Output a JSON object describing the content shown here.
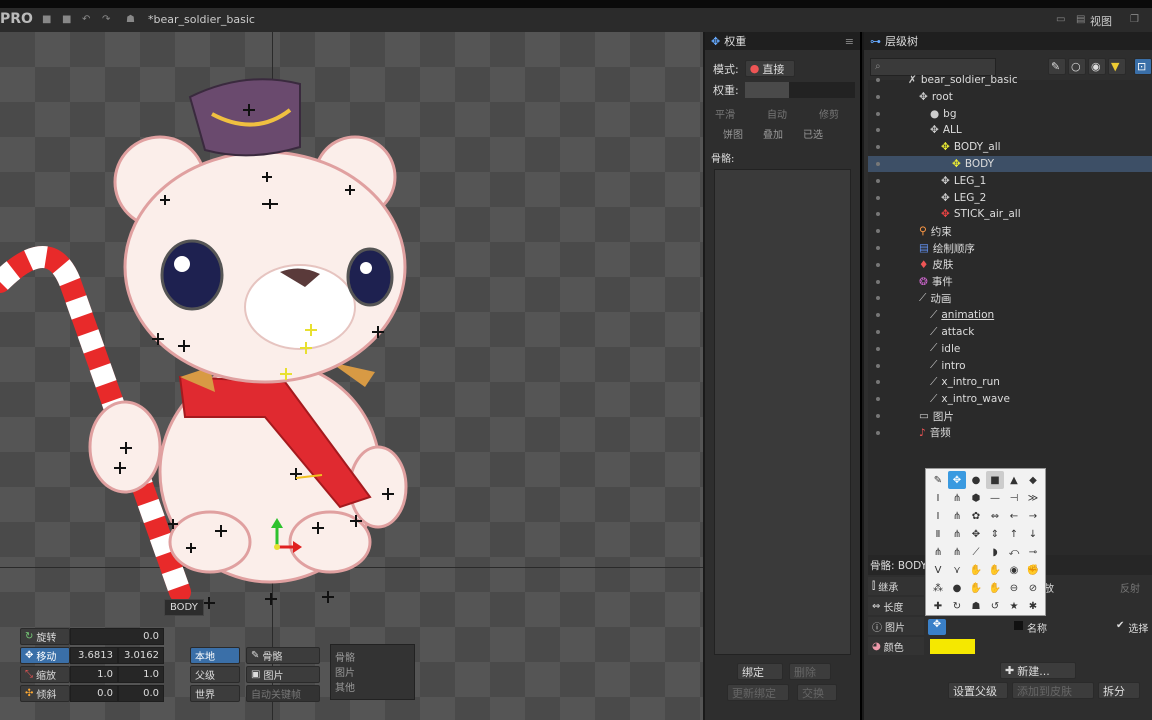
{
  "app": {
    "logo": "PRO",
    "doc_title": "*bear_soldier_basic",
    "view_label": "视图"
  },
  "viewport": {
    "bone_tag": "BODY"
  },
  "tools": {
    "rotate": {
      "label": "旋转",
      "v1": "0.0"
    },
    "translate": {
      "label": "移动",
      "v1": "3.6813",
      "v2": "3.0162"
    },
    "scale": {
      "label": "缩放",
      "v1": "1.0",
      "v2": "1.0"
    },
    "shear": {
      "label": "倾斜",
      "v1": "0.0",
      "v2": "0.0"
    },
    "local": "本地",
    "parent": "父级",
    "world": "世界",
    "bones": "骨骼",
    "images": "图片",
    "auto_key": "自动关键帧",
    "vis_bones": "骨骼",
    "vis_images": "图片",
    "vis_other": "其他"
  },
  "weights": {
    "tab": "权重",
    "mode_label": "模式:",
    "mode_value": "直接",
    "weight_label": "权重:",
    "smooth": "平滑",
    "auto": "自动",
    "prune": "修剪",
    "pie": "饼图",
    "overlay": "叠加",
    "selected": "已选",
    "bones_label": "骨骼:",
    "bind": "绑定",
    "delete": "删除",
    "update_bind": "更新绑定",
    "swap": "交换"
  },
  "tree": {
    "tab": "层级树",
    "search_placeholder": "",
    "nodes": [
      {
        "label": "bear_soldier_basic",
        "indent": 0,
        "icon": "skeleton"
      },
      {
        "label": "root",
        "indent": 1,
        "icon": "bone"
      },
      {
        "label": "bg",
        "indent": 2,
        "icon": "circle"
      },
      {
        "label": "ALL",
        "indent": 2,
        "icon": "bone"
      },
      {
        "label": "BODY_all",
        "indent": 3,
        "icon": "bone-yellow"
      },
      {
        "label": "BODY",
        "indent": 4,
        "icon": "bone-yellow",
        "selected": true
      },
      {
        "label": "LEG_1",
        "indent": 3,
        "icon": "bone"
      },
      {
        "label": "LEG_2",
        "indent": 3,
        "icon": "bone"
      },
      {
        "label": "STICK_air_all",
        "indent": 3,
        "icon": "bone-red"
      },
      {
        "label": "约束",
        "indent": 1,
        "icon": "constraint"
      },
      {
        "label": "绘制顺序",
        "indent": 1,
        "icon": "draworder"
      },
      {
        "label": "皮肤",
        "indent": 1,
        "icon": "skin"
      },
      {
        "label": "事件",
        "indent": 1,
        "icon": "event"
      },
      {
        "label": "动画",
        "indent": 1,
        "icon": "anim"
      },
      {
        "label": "animation",
        "indent": 2,
        "icon": "anim-item",
        "underline": true
      },
      {
        "label": "attack",
        "indent": 2,
        "icon": "anim-item"
      },
      {
        "label": "idle",
        "indent": 2,
        "icon": "anim-item"
      },
      {
        "label": "intro",
        "indent": 2,
        "icon": "anim-item"
      },
      {
        "label": "x_intro_run",
        "indent": 2,
        "icon": "anim-item"
      },
      {
        "label": "x_intro_wave",
        "indent": 2,
        "icon": "anim-item"
      },
      {
        "label": "图片",
        "indent": 1,
        "icon": "folder"
      },
      {
        "label": "音频",
        "indent": 1,
        "icon": "audio"
      }
    ],
    "props": {
      "header": "骨骼: BODY",
      "inherit": "继承",
      "length": "长度",
      "image": "图片",
      "color": "颜色",
      "color_value": "#f5e800",
      "name": "名称",
      "select": "选择",
      "release": "放",
      "reflect": "反射",
      "new": "新建...",
      "set_parent": "设置父级",
      "add_to_skin": "添加到皮肤",
      "split": "拆分"
    }
  }
}
